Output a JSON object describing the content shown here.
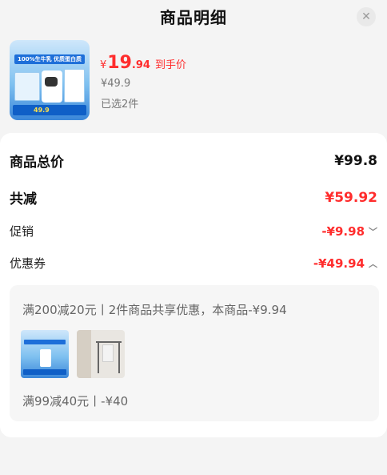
{
  "header": {
    "title": "商品明细",
    "close_icon": "close-icon",
    "close_glyph": "✕"
  },
  "product": {
    "thumb_banner_text": "100%生牛乳 优质蛋白质",
    "thumb_price_text": "49.9",
    "currency": "¥",
    "price_integer": "19",
    "price_decimal": ".94",
    "price_tag": "到手价",
    "original_price": "¥49.9",
    "selected_text": "已选2件"
  },
  "summary": {
    "total_label": "商品总价",
    "total_value": "¥99.8",
    "reduce_label": "共减",
    "reduce_value": "¥59.92",
    "promo_label": "促销",
    "promo_value": "-¥9.98",
    "promo_chevron": "﹀",
    "coupon_label": "优惠券",
    "coupon_value": "-¥49.94",
    "coupon_chevron": "︿"
  },
  "coupon_details": {
    "line1": "满200减20元丨2件商品共享优惠，本商品-¥9.94",
    "line2": "满99减40元丨-¥40",
    "thumbnails": [
      "milk-product-thumbnail",
      "clothes-rack-thumbnail"
    ]
  },
  "colors": {
    "accent_red": "#ff2d2d",
    "background": "#f4f4f4",
    "card": "#ffffff"
  }
}
